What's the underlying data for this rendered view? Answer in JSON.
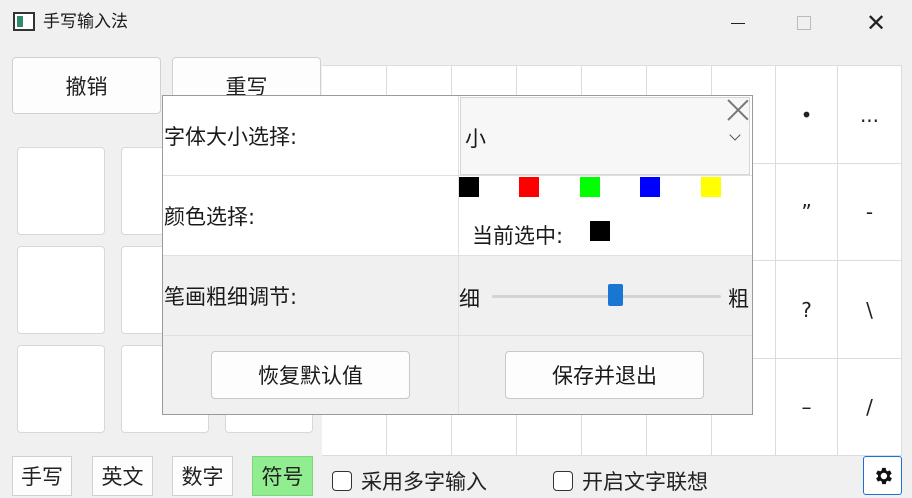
{
  "window": {
    "title": "手写输入法",
    "minimize": "—",
    "maximize": "□",
    "close": "✕"
  },
  "toolbar": {
    "undo": "撤销",
    "rewrite": "重写"
  },
  "symbol_grid": {
    "visible_symbols": [
      "•",
      "...",
      "”",
      "-",
      "?",
      "\\",
      "–",
      "/"
    ]
  },
  "bottom_bar": {
    "modes": [
      "手写",
      "英文",
      "数字",
      "符号"
    ],
    "active_mode": "符号",
    "multi_char_label": "采用多字输入",
    "association_label": "开启文字联想",
    "settings_icon": "gear-icon"
  },
  "settings_dialog": {
    "font_size_label": "字体大小选择:",
    "font_size_value": "小",
    "color_label": "颜色选择:",
    "colors": [
      "#000000",
      "#ff0000",
      "#00ff00",
      "#0000ff",
      "#ffff00"
    ],
    "current_label": "当前选中:",
    "current_color": "#000000",
    "stroke_label": "笔画粗细调节:",
    "stroke_thin": "细",
    "stroke_thick": "粗",
    "stroke_level": 0.54,
    "restore_button": "恢复默认值",
    "save_button": "保存并退出"
  },
  "colors": {
    "accent": "#1976d2",
    "active_mode_bg": "#90ee90",
    "window_bg": "#f0f0f0"
  }
}
